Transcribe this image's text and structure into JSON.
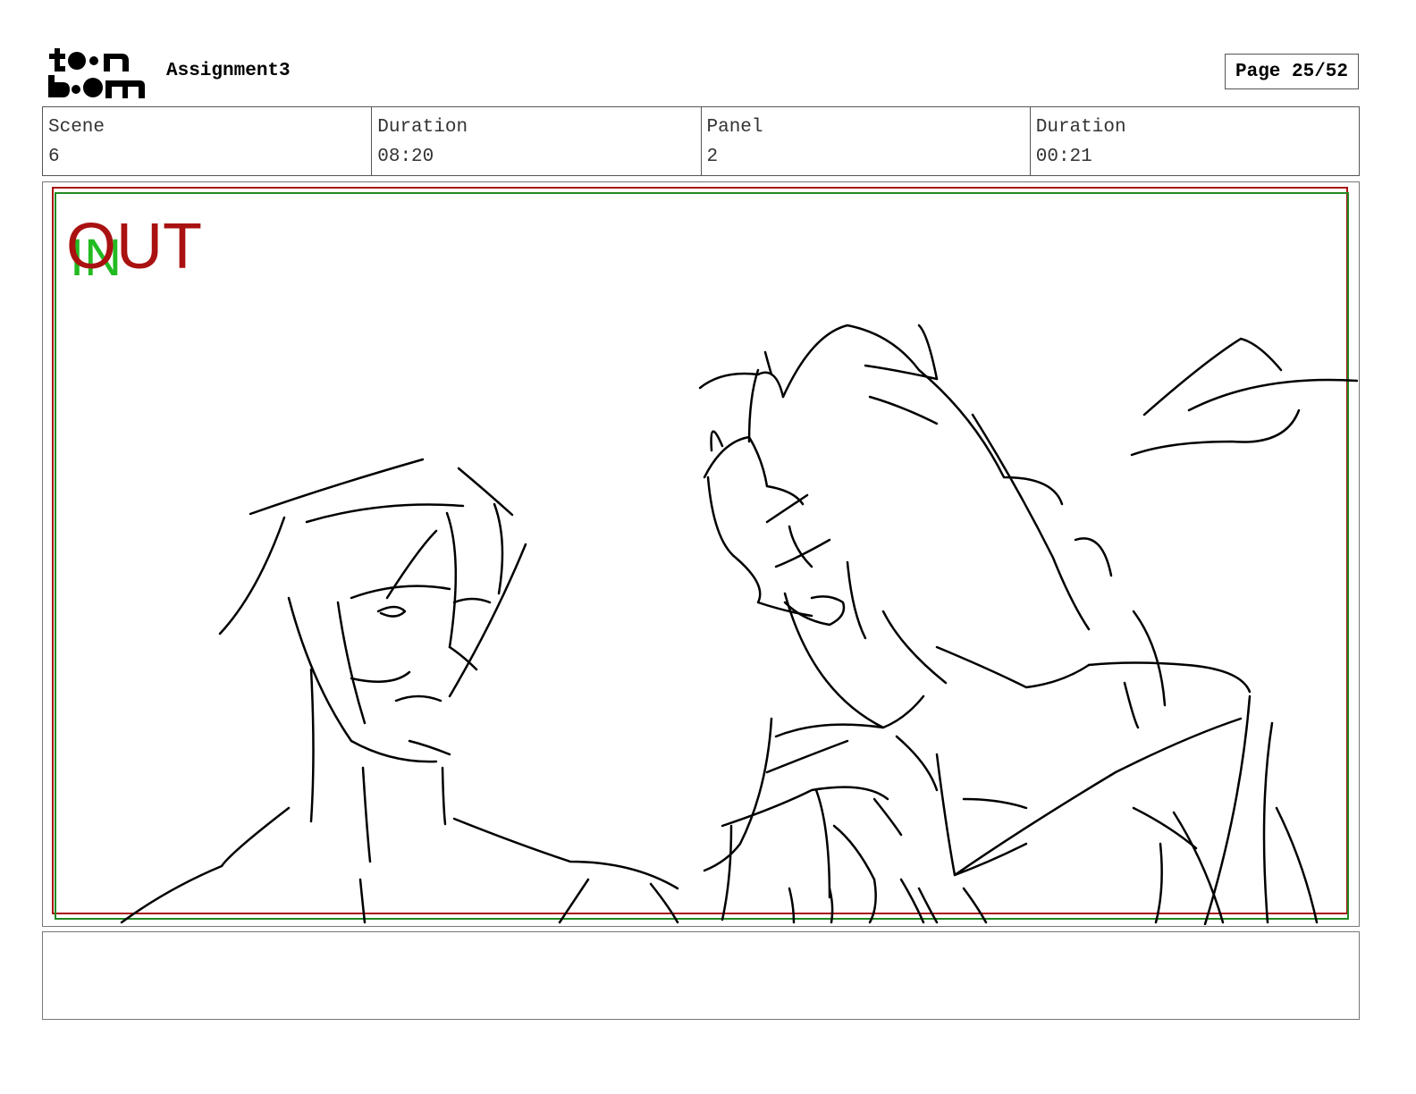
{
  "header": {
    "logo_text": "toon boom",
    "project_title": "Assignment3",
    "page_label": "Page 25/52"
  },
  "info": {
    "scene_label": "Scene",
    "scene_value": "6",
    "scene_duration_label": "Duration",
    "scene_duration_value": "08:20",
    "panel_label": "Panel",
    "panel_value": "2",
    "panel_duration_label": "Duration",
    "panel_duration_value": "00:21"
  },
  "panel": {
    "in_marker": "IN",
    "out_marker": "OUT",
    "in_color": "#22bb22",
    "out_color": "#aa1111",
    "safe_frame_colors": [
      "#aa1111",
      "#228822"
    ]
  },
  "notes": {
    "text": ""
  }
}
